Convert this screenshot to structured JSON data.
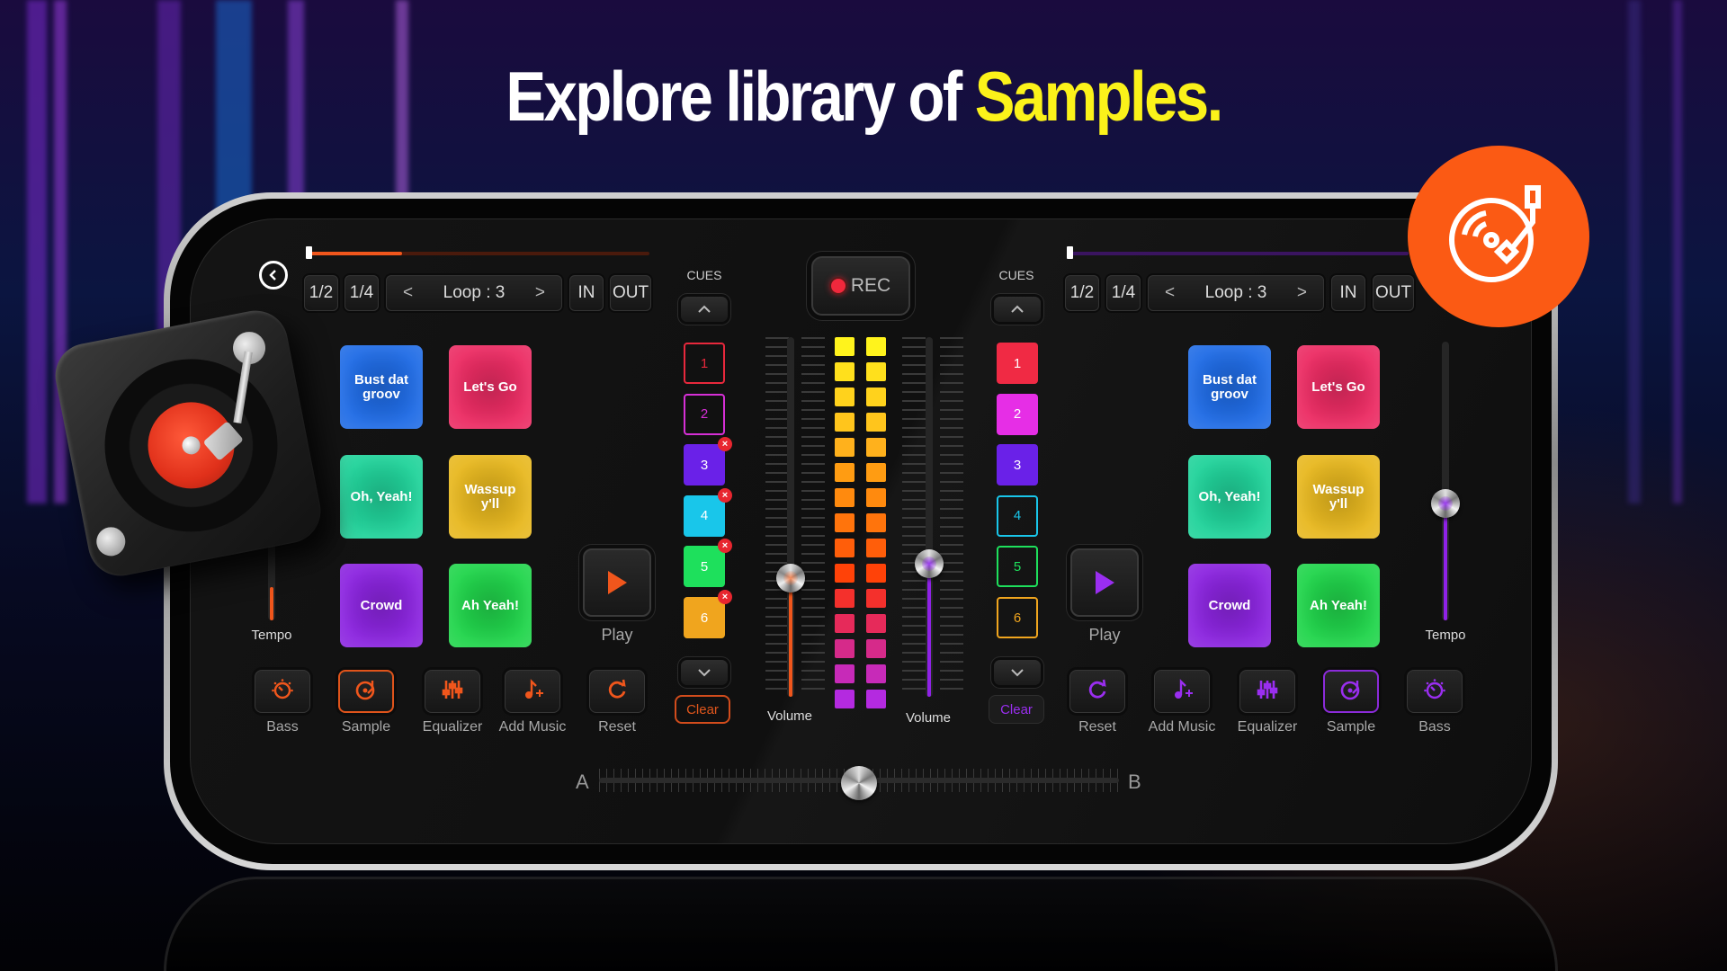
{
  "headline": {
    "prefix": "Explore library of ",
    "highlight": "Samples."
  },
  "colors": {
    "deck_a_accent": "#f0561c",
    "deck_b_accent": "#8f22e6",
    "highlight": "#fbf21a",
    "badge": "#fb5a14"
  },
  "badge_icon": "turntable-icon",
  "back_label": "back",
  "decks": {
    "a": {
      "progress": 0.28,
      "buttons": {
        "half": "1/2",
        "quarter": "1/4",
        "loop": "Loop : 3",
        "prev": "<",
        "next": ">",
        "in": "IN",
        "out": "OUT"
      },
      "pads": [
        {
          "label": "Bust dat groov",
          "color": "#1e6be6"
        },
        {
          "label": "Let's Go",
          "color": "#ec2a62"
        },
        {
          "label": "Oh, Yeah!",
          "color": "#1fd39a"
        },
        {
          "label": "Wassup y'll",
          "color": "#e8b81e"
        },
        {
          "label": "Crowd",
          "color": "#8b23e0"
        },
        {
          "label": "Ah Yeah!",
          "color": "#1fd54a"
        }
      ],
      "play_label": "Play",
      "tempo_label": "Tempo",
      "tempo_value": 0.12,
      "fx": [
        {
          "label": "Bass",
          "icon": "bass-knob-icon"
        },
        {
          "label": "Sample",
          "icon": "sample-disc-icon",
          "active": true
        },
        {
          "label": "Equalizer",
          "icon": "equalizer-icon"
        },
        {
          "label": "Add Music",
          "icon": "add-music-icon"
        },
        {
          "label": "Reset",
          "icon": "reset-icon"
        }
      ],
      "cues_label": "CUES",
      "cues": [
        {
          "n": "1",
          "color": "#e8283c",
          "set": false
        },
        {
          "n": "2",
          "color": "#d62fd6",
          "set": false
        },
        {
          "n": "3",
          "color": "#6a21e8",
          "set": true
        },
        {
          "n": "4",
          "color": "#19c6ea",
          "set": true
        },
        {
          "n": "5",
          "color": "#1ee05c",
          "set": true
        },
        {
          "n": "6",
          "color": "#f0a51e",
          "set": true
        }
      ],
      "clear_label": "Clear",
      "volume_label": "Volume",
      "volume": 0.33
    },
    "b": {
      "progress": 0.0,
      "buttons": {
        "half": "1/2",
        "quarter": "1/4",
        "loop": "Loop : 3",
        "prev": "<",
        "next": ">",
        "in": "IN",
        "out": "OUT"
      },
      "pads": [
        {
          "label": "Bust dat groov",
          "color": "#1e6be6"
        },
        {
          "label": "Let's Go",
          "color": "#ec2a62"
        },
        {
          "label": "Oh, Yeah!",
          "color": "#1fd39a"
        },
        {
          "label": "Wassup y'll",
          "color": "#e8b81e"
        },
        {
          "label": "Crowd",
          "color": "#8b23e0"
        },
        {
          "label": "Ah Yeah!",
          "color": "#1fd54a"
        }
      ],
      "play_label": "Play",
      "tempo_label": "Tempo",
      "tempo_value": 0.42,
      "fx": [
        {
          "label": "Reset",
          "icon": "reset-icon"
        },
        {
          "label": "Add Music",
          "icon": "add-music-icon"
        },
        {
          "label": "Equalizer",
          "icon": "equalizer-icon"
        },
        {
          "label": "Sample",
          "icon": "sample-disc-icon",
          "active": true
        },
        {
          "label": "Bass",
          "icon": "bass-knob-icon"
        }
      ],
      "cues_label": "CUES",
      "cues": [
        {
          "n": "1",
          "color": "#f02a44",
          "set": true
        },
        {
          "n": "2",
          "color": "#e62ee6",
          "set": true
        },
        {
          "n": "3",
          "color": "#6a21e8",
          "set": true
        },
        {
          "n": "4",
          "color": "#19c6ea",
          "set": false
        },
        {
          "n": "5",
          "color": "#1ee05c",
          "set": false
        },
        {
          "n": "6",
          "color": "#f0a51e",
          "set": false
        }
      ],
      "clear_label": "Clear",
      "volume_label": "Volume",
      "volume": 0.37
    }
  },
  "rec_label": "REC",
  "meter": {
    "levels": 15,
    "colors": [
      "#fff31c",
      "#ffe01c",
      "#ffd21c",
      "#ffc51c",
      "#ffb11c",
      "#ff9c12",
      "#ff8a0e",
      "#ff740c",
      "#ff5e0a",
      "#ff4208",
      "#f4302c",
      "#e62a5a",
      "#d62a8a",
      "#c72ab8",
      "#b42ae0"
    ]
  },
  "crossfader": {
    "left_label": "A",
    "right_label": "B",
    "position": 0.5
  }
}
